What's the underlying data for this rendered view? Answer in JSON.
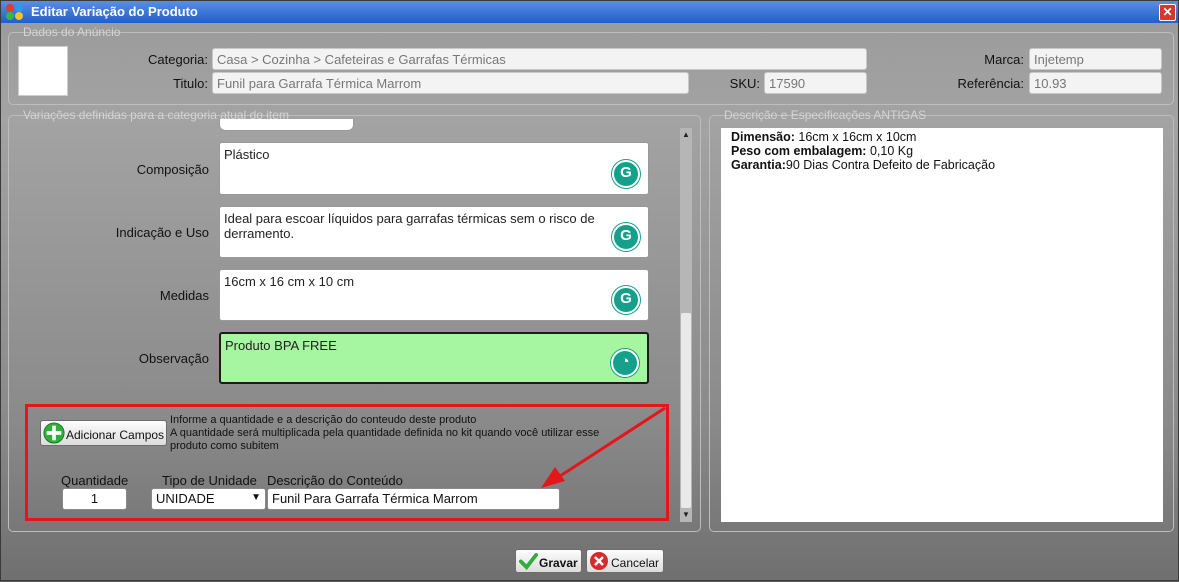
{
  "window": {
    "title": "Editar Variação do Produto",
    "close_label": "✕"
  },
  "anuncio": {
    "legend": "Dados do Anúncio",
    "categoria_label": "Categoria:",
    "categoria_value": "Casa > Cozinha > Cafeteiras e Garrafas Térmicas",
    "titulo_label": "Titulo:",
    "titulo_value": "Funil para Garrafa Térmica Marrom",
    "sku_label": "SKU:",
    "sku_value": "17590",
    "marca_label": "Marca:",
    "marca_value": "Injetemp",
    "referencia_label": "Referência:",
    "referencia_value": "10.93"
  },
  "variacoes": {
    "legend": "Variações definidas para a categoria atual do item",
    "fields": [
      {
        "label": "Composição",
        "value": "Plástico"
      },
      {
        "label": "Indicação e Uso",
        "value": "Ideal para escoar líquidos para garrafas térmicas sem o risco de derramento."
      },
      {
        "label": "Medidas",
        "value": "16cm x 16 cm x 10 cm"
      },
      {
        "label": "Observação",
        "value": "Produto BPA FREE"
      }
    ]
  },
  "kit": {
    "add_button": "Adicionar Campos",
    "info_line1": "Informe a quantidade e a descrição do conteudo deste produto",
    "info_line2": "A quantidade será multiplicada pela quantidade definida no kit quando você utilizar esse",
    "info_line3": "produto como subitem",
    "qtd_label": "Quantidade",
    "qtd_value": "1",
    "unidade_label": "Tipo de Unidade",
    "unidade_value": "UNIDADE",
    "desc_label": "Descrição do Conteúdo",
    "desc_value": "Funil Para Garrafa Térmica Marrom"
  },
  "antigas": {
    "legend": "Descrição e Especificações ANTIGAS",
    "lines": [
      {
        "key": "Dimensão:",
        "value": " 16cm x 16cm x 10cm"
      },
      {
        "key": "Peso com embalagem:",
        "value": " 0,10 Kg"
      },
      {
        "key": "Garantia:",
        "value": "90 Dias Contra Defeito de Fabricação"
      }
    ]
  },
  "footer": {
    "save_label": "Gravar",
    "cancel_label": "Cancelar"
  },
  "colors": {
    "title_bar": "#1f5fcf",
    "highlight_field": "#a6f5a0",
    "annotation_red": "#e3161c",
    "grammarly": "#15a08b"
  }
}
